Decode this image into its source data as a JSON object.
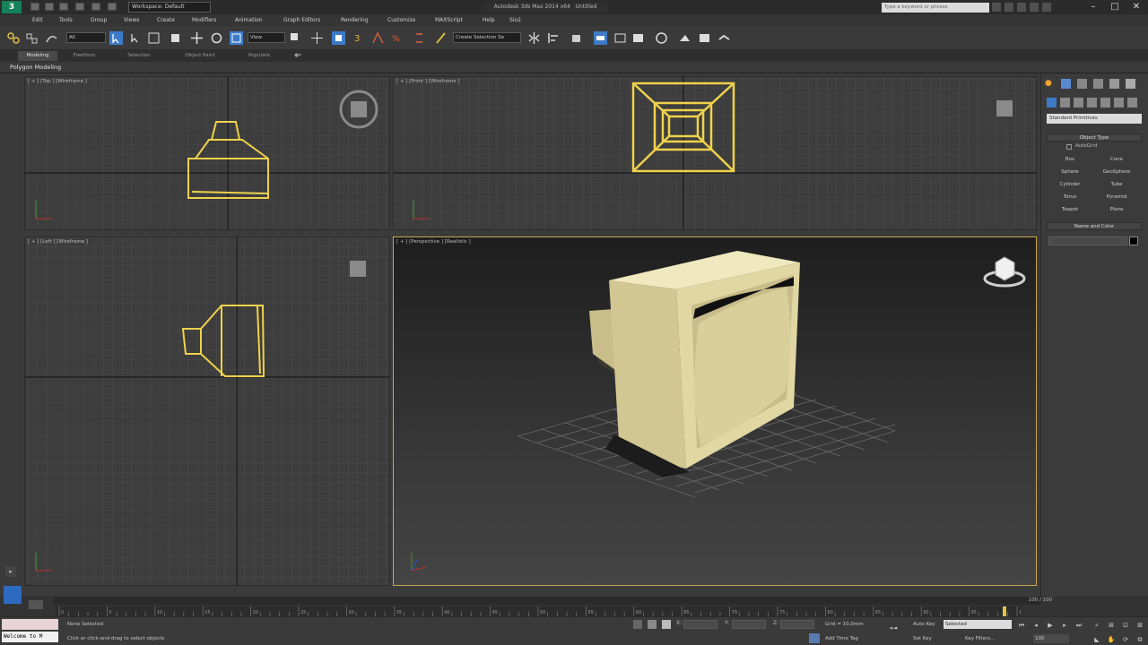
{
  "titlebar": {
    "logo": "3",
    "workspace": "Workspace: Default",
    "window_title": "Autodesk 3ds Max 2014 x64",
    "document": "Untitled",
    "search_placeholder": "Type a keyword or phrase"
  },
  "menu": [
    "Edit",
    "Tools",
    "Group",
    "Views",
    "Create",
    "Modifiers",
    "Animation",
    "Graph Editors",
    "Rendering",
    "Customize",
    "MAXScript",
    "Help",
    "Sio2"
  ],
  "toolbar": {
    "selection_filter": "All",
    "ref_coord": "View",
    "named_selection": "Create Selection Se"
  },
  "ribbon": {
    "tabs": [
      "Modeling",
      "Freeform",
      "Selection",
      "Object Paint",
      "Populate"
    ],
    "active_tab": "Modeling",
    "panel_label": "Polygon Modeling"
  },
  "viewports": {
    "top": "[ + ] [Top ] [Wireframe ]",
    "front": "[ + ] [Front ] [Wireframe ]",
    "left": "[ + ] [Left ] [Wireframe ]",
    "perspective": "[ + ] [Perspective ] [Realistic ]"
  },
  "command_panel": {
    "primitive_type": "Standard Primitives",
    "object_type_header": "Object Type",
    "autogrid": "AutoGrid",
    "object_buttons": [
      "Box",
      "Cone",
      "Sphere",
      "GeoSphere",
      "Cylinder",
      "Tube",
      "Torus",
      "Pyramid",
      "Teapot",
      "Plane"
    ],
    "name_color_header": "Name and Color"
  },
  "timeline": {
    "frame_counter": "100 / 100",
    "ruler_ticks": [
      "0",
      "5",
      "10",
      "15",
      "20",
      "25",
      "30",
      "35",
      "40",
      "45",
      "50",
      "55",
      "60",
      "65",
      "70",
      "75",
      "80",
      "85",
      "90",
      "95",
      "100"
    ]
  },
  "statusbar": {
    "maxscript_text": "Welcome to M",
    "selection_status": "None Selected",
    "prompt": "Click or click-and-drag to select objects",
    "x_label": "X:",
    "y_label": "Y:",
    "z_label": "Z:",
    "grid": "Grid = 10,0mm",
    "auto_key": "Auto Key",
    "set_key": "Set Key",
    "key_mode": "Selected",
    "key_filters": "Key Filters...",
    "add_time_tag": "Add Time Tag",
    "frame": "100"
  },
  "colors": {
    "object_yellow": "#e8d26a",
    "persp_border": "#c9a84a",
    "monitor_face": "#e2d9a4"
  }
}
